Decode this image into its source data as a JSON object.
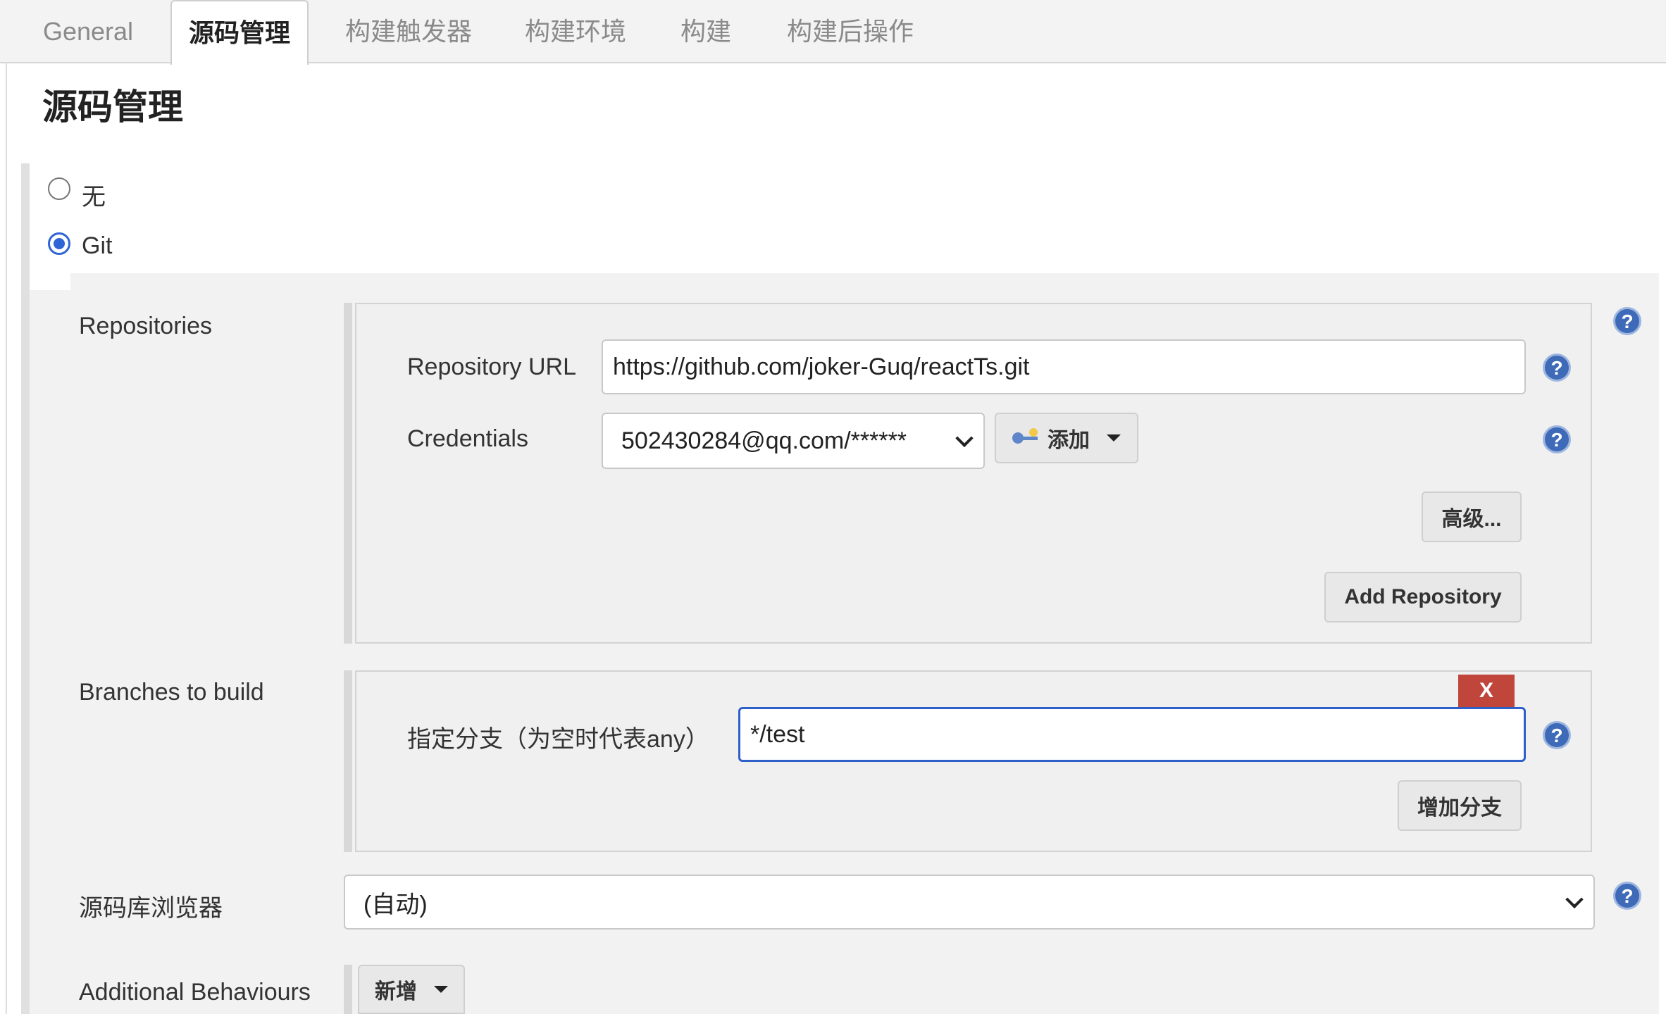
{
  "tabs": [
    {
      "label": "General"
    },
    {
      "label": "源码管理"
    },
    {
      "label": "构建触发器"
    },
    {
      "label": "构建环境"
    },
    {
      "label": "构建"
    },
    {
      "label": "构建后操作"
    }
  ],
  "section": {
    "title": "源码管理"
  },
  "scm_options": [
    {
      "label": "无",
      "selected": false
    },
    {
      "label": "Git",
      "selected": true
    }
  ],
  "repositories": {
    "label": "Repositories",
    "url_label": "Repository URL",
    "url_value": "https://github.com/joker-Guq/reactTs.git",
    "credentials_label": "Credentials",
    "credentials_value": "502430284@qq.com/******",
    "add_button": "添加",
    "advanced_button": "高级...",
    "add_repository_button": "Add Repository"
  },
  "branches": {
    "label": "Branches to build",
    "delete_button": "X",
    "branch_label": "指定分支（为空时代表any）",
    "branch_value": "*/test",
    "add_branch_button": "增加分支"
  },
  "browser": {
    "label": "源码库浏览器",
    "value": "(自动)"
  },
  "behaviours": {
    "label": "Additional Behaviours",
    "add_button": "新增"
  },
  "help_glyph": "?",
  "colors": {
    "accent": "#2f64d6",
    "help": "#3e6ab7",
    "danger": "#c0463b"
  }
}
